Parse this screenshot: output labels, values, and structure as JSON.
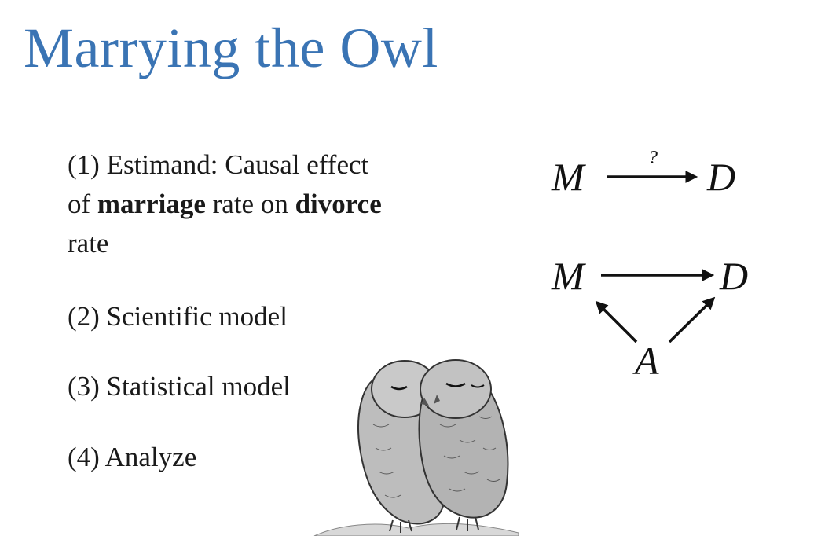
{
  "slide": {
    "title": "Marrying the Owl",
    "steps": [
      {
        "number": "(1)",
        "parts": [
          "Estimand: Causal effect",
          "of ",
          "marriage",
          " rate on ",
          "divorce",
          "rate"
        ]
      },
      {
        "text": "(2) Scientific model"
      },
      {
        "text": "(3) Statistical model"
      },
      {
        "text": "(4) Analyze"
      }
    ]
  },
  "diagram": {
    "top": {
      "from": "M",
      "to": "D",
      "edge_label": "?"
    },
    "bottom": {
      "nodes": {
        "m": "M",
        "d": "D",
        "a": "A"
      }
    }
  }
}
